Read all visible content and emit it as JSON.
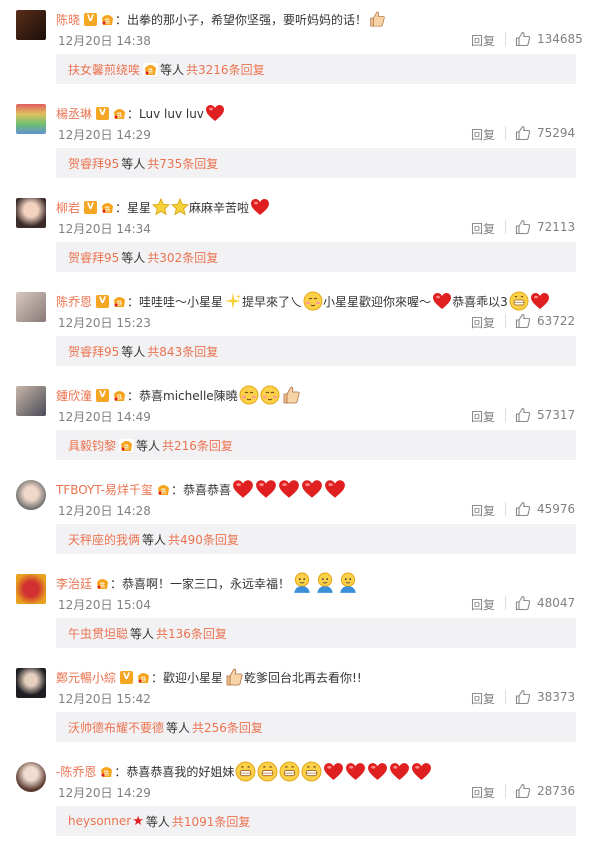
{
  "reply_label": "回复",
  "colors": {
    "username": "#eb7350",
    "time": "#808080",
    "sub_bg": "#f2f2f5",
    "heart": "#e02020"
  },
  "comments": [
    {
      "user": "陈晓",
      "text": "：出拳的那小子，希望你坚强，要听妈妈的话！",
      "time": "12月20日 14:38",
      "likes": "134685",
      "sub_user": "扶女馨煎绕唉",
      "sub_mid": "等人",
      "sub_count": "共3216条回复"
    },
    {
      "user": "楊丞琳",
      "text": "：Luv luv luv",
      "time": "12月20日 14:29",
      "likes": "75294",
      "sub_user": "贺睿拜95",
      "sub_mid": "等人",
      "sub_count": "共735条回复"
    },
    {
      "user": "柳岩",
      "text": "：星星",
      "text2": "麻麻辛苦啦",
      "time": "12月20日 14:34",
      "likes": "72113",
      "sub_user": "贺睿拜95",
      "sub_mid": "等人",
      "sub_count": "共302条回复"
    },
    {
      "user": "陈乔恩",
      "text": "：哇哇哇～小星星",
      "text2": "提早來了乀",
      "text3": "小星星歡迎你來喔～",
      "text4": "恭喜乖以3",
      "time": "12月20日 15:23",
      "likes": "63722",
      "sub_user": "贺睿拜95",
      "sub_mid": "等人",
      "sub_count": "共843条回复"
    },
    {
      "user": "鍾欣潼",
      "text": "：恭喜michelle陳曉",
      "time": "12月20日 14:49",
      "likes": "57317",
      "sub_user": "具毅钧黎",
      "sub_mid": "等人",
      "sub_count": "共216条回复"
    },
    {
      "user": "TFBOYT-易烊千玺",
      "text": "：恭喜恭喜",
      "time": "12月20日 14:28",
      "likes": "45976",
      "sub_user": "天秤座的我俩",
      "sub_mid": "等人",
      "sub_count": "共490条回复"
    },
    {
      "user": "李治廷",
      "text": "：恭喜啊！一家三口，永远幸福！",
      "time": "12月20日 15:04",
      "likes": "48047",
      "sub_user": "午虫贯坦聪",
      "sub_mid": "等人",
      "sub_count": "共136条回复"
    },
    {
      "user": "鄭元暢小綜",
      "text": "：歡迎小星星",
      "text2": "乾爹回台北再去看你!!",
      "time": "12月20日 15:42",
      "likes": "38373",
      "sub_user": "沃帅德布耀不要德",
      "sub_mid": "等人",
      "sub_count": "共256条回复"
    },
    {
      "user": "-陈乔恩",
      "text": "：恭喜恭喜我的好姐妹",
      "time": "12月20日 14:29",
      "likes": "28736",
      "sub_user": "heysonner",
      "sub_mid": "等人",
      "sub_count": "共1091条回复"
    }
  ]
}
